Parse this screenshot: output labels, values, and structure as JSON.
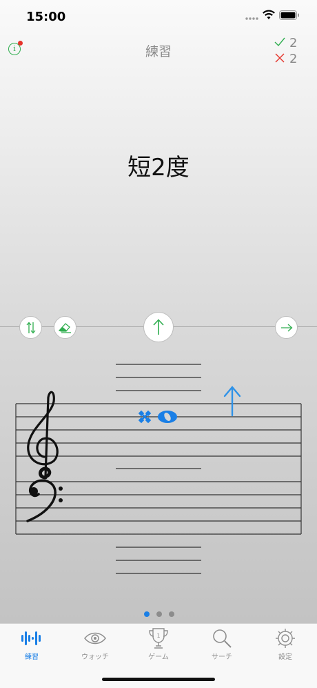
{
  "status": {
    "time": "15:00"
  },
  "header": {
    "title": "練習"
  },
  "score": {
    "correct": "2",
    "wrong": "2",
    "correct_color": "#2fae4f",
    "wrong_color": "#e5332a"
  },
  "prompt": {
    "text": "短2度"
  },
  "controls": {
    "swap": "swap-arrows-icon",
    "eraser": "eraser-icon",
    "submit": "up-arrow-icon",
    "next": "right-arrow-icon",
    "accent": "#2fae4f"
  },
  "staff": {
    "accidental": "double-sharp",
    "note": "whole-note",
    "note_color": "#1a7fe6",
    "direction": "up"
  },
  "pager": {
    "pages": 3,
    "current": 1
  },
  "tabs": [
    {
      "label": "練習",
      "icon": "waveform-icon",
      "active": true
    },
    {
      "label": "ウォッチ",
      "icon": "eye-icon",
      "active": false
    },
    {
      "label": "ゲーム",
      "icon": "trophy-icon",
      "active": false
    },
    {
      "label": "サーチ",
      "icon": "search-icon",
      "active": false
    },
    {
      "label": "設定",
      "icon": "gear-icon",
      "active": false
    }
  ]
}
